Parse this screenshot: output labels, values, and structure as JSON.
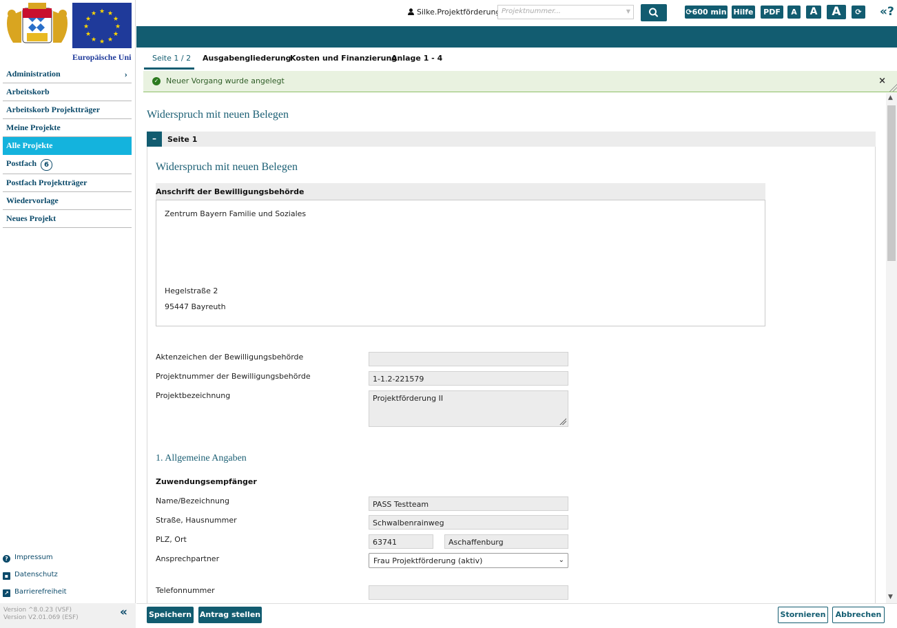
{
  "sidebar": {
    "eu_label": "Europäische Uni",
    "nav": [
      {
        "label": "Administration",
        "has_chevron": true
      },
      {
        "label": "Arbeitskorb"
      },
      {
        "label": "Arbeitskorb Projektträger"
      },
      {
        "label": "Meine Projekte"
      },
      {
        "label": "Alle Projekte",
        "active": true
      },
      {
        "label": "Postfach",
        "badge": "6"
      },
      {
        "label": "Postfach Projektträger"
      },
      {
        "label": "Wiedervorlage"
      },
      {
        "label": "Neues Projekt"
      }
    ],
    "footer_links": {
      "impressum": "Impressum",
      "datenschutz": "Datenschutz",
      "barrierefreiheit": "Barrierefreiheit"
    },
    "version_vsf": "Version ^8.0.23 (VSF)",
    "version_esf": "Version V2.01.069 (ESF)"
  },
  "topbar": {
    "user": "Silke.Projektförderung",
    "search_placeholder": "Projektnummer...",
    "session": "600 min",
    "help": "Hilfe",
    "pdf": "PDF",
    "font_small": "A",
    "font_medium": "A",
    "font_large": "A",
    "help_icon": "«?"
  },
  "tabs": [
    "Seite 1 / 2",
    "Ausgabengliederung",
    "Kosten und Finanzierung",
    "Anlage 1 - 4"
  ],
  "notification": {
    "message": "Neuer Vorgang wurde angelegt"
  },
  "page": {
    "title": "Widerspruch mit neuen Belegen",
    "section_toggle": "–",
    "section_title": "Seite 1",
    "form_title": "Widerspruch mit neuen Belegen",
    "address": {
      "heading": "Anschrift der Bewilligungsbehörde",
      "line1": "Zentrum Bayern Familie und Soziales",
      "street": "Hegelstraße 2",
      "city": "95447  Bayreuth"
    },
    "fields": {
      "aktenzeichen_label": "Aktenzeichen der Bewilligungsbehörde",
      "aktenzeichen_value": "",
      "projektnummer_label": "Projektnummer der Bewilligungsbehörde",
      "projektnummer_value": "1-1.2-221579",
      "bezeichnung_label": "Projektbezeichnung",
      "bezeichnung_value": "Projektförderung II"
    },
    "section2_title": "1. Allgemeine Angaben",
    "recipient": {
      "heading": "Zuwendungsempfänger",
      "name_label": "Name/Bezeichnung",
      "name_value": "PASS Testteam",
      "street_label": "Straße, Hausnummer",
      "street_value": "Schwalbenrainweg",
      "plz_label": "PLZ, Ort",
      "plz_value": "63741",
      "ort_value": "Aschaffenburg",
      "contact_label": "Ansprechpartner",
      "contact_value": "Frau Projektförderung (aktiv)",
      "phone_label": "Telefonnummer",
      "phone_value": ""
    }
  },
  "bottom": {
    "save": "Speichern",
    "submit": "Antrag stellen",
    "cancel": "Stornieren",
    "abort": "Abbrechen"
  },
  "colors": {
    "primary": "#125c70",
    "active_nav": "#14b3dd",
    "success_bg": "#e9f2e0"
  }
}
